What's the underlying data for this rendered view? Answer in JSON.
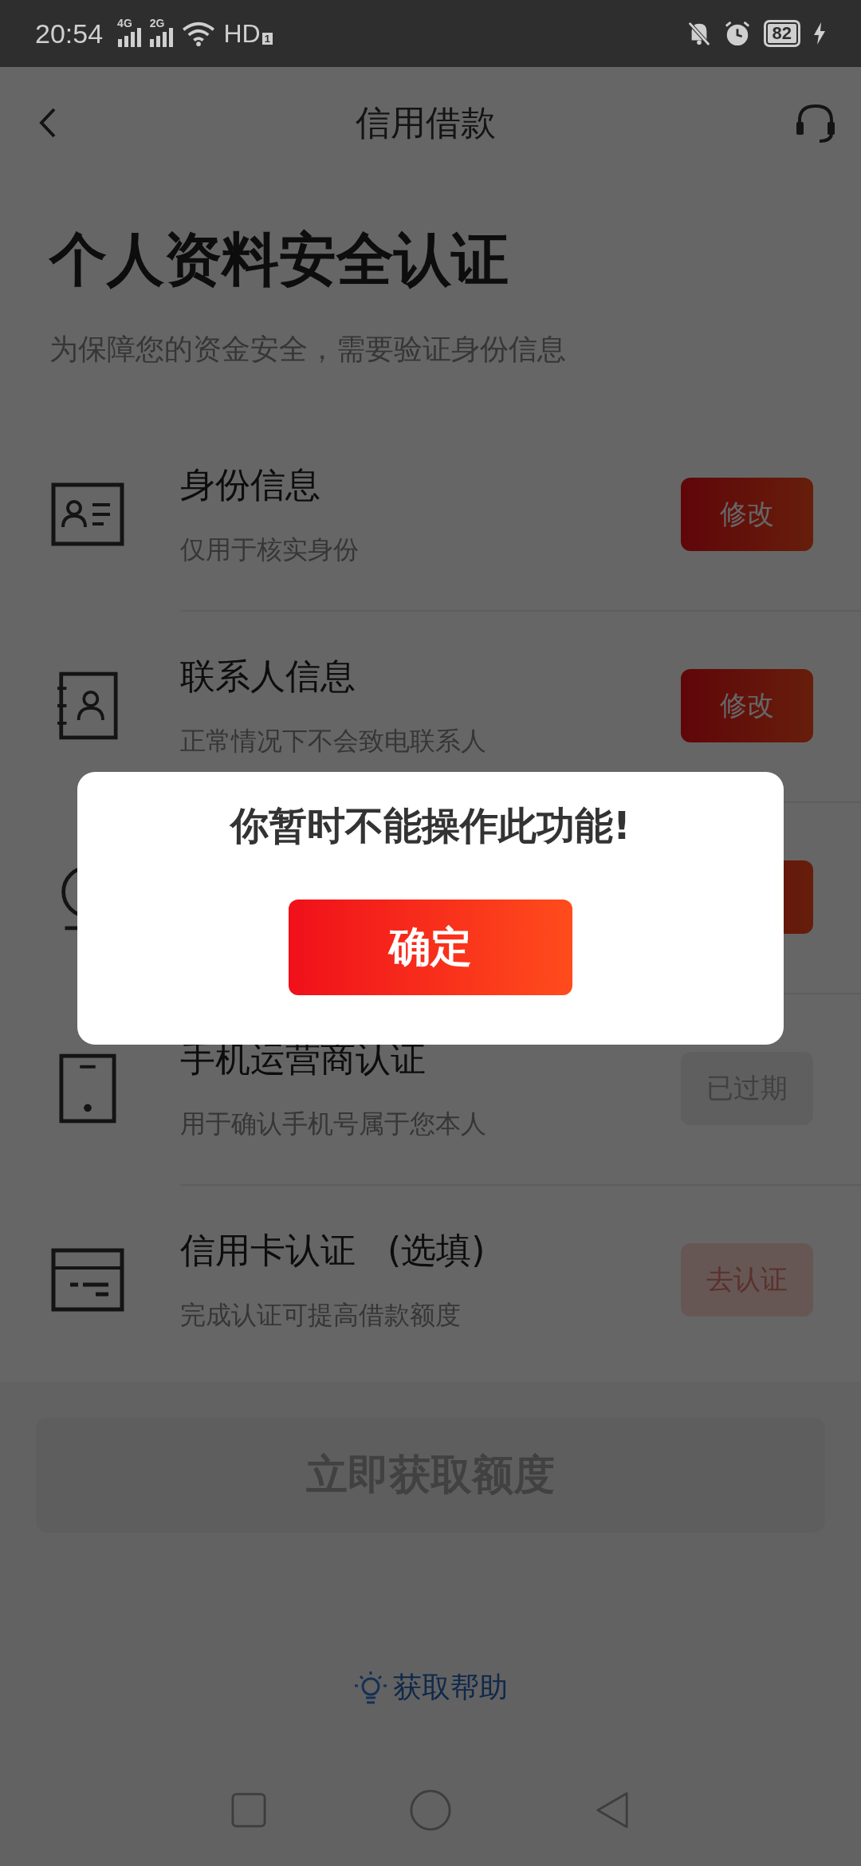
{
  "status_bar": {
    "time": "20:54",
    "sim_1": "4G",
    "sim_2": "2G",
    "network": "HD",
    "network_slot": "1",
    "battery": "82"
  },
  "header": {
    "title": "信用借款"
  },
  "heading": "个人资料安全认证",
  "subheading": "为保障您的资金安全，需要验证身份信息",
  "items": [
    {
      "kind": "id-card",
      "title": "身份信息",
      "note": "仅用于核实身份",
      "button": {
        "kind": "edit",
        "label": "修改"
      }
    },
    {
      "kind": "contact",
      "title": "联系人信息",
      "note": "正常情况下不会致电联系人",
      "button": {
        "kind": "edit",
        "label": "修改"
      }
    },
    {
      "kind": "face",
      "button": {
        "kind": "edit"
      }
    },
    {
      "kind": "phone",
      "title": "手机运营商认证",
      "note": "用于确认手机号属于您本人",
      "button": {
        "kind": "expired",
        "label": "已过期"
      }
    },
    {
      "kind": "card",
      "title": "信用卡认证",
      "tag": "(选填)",
      "note": "完成认证可提高借款额度",
      "button": {
        "kind": "todo",
        "label": "去认证"
      }
    }
  ],
  "main_button": {
    "label": "立即获取额度",
    "disabled": true
  },
  "help_link": "获取帮助",
  "dialog": {
    "message": "你暂时不能操作此功能!",
    "confirm": "确定"
  }
}
